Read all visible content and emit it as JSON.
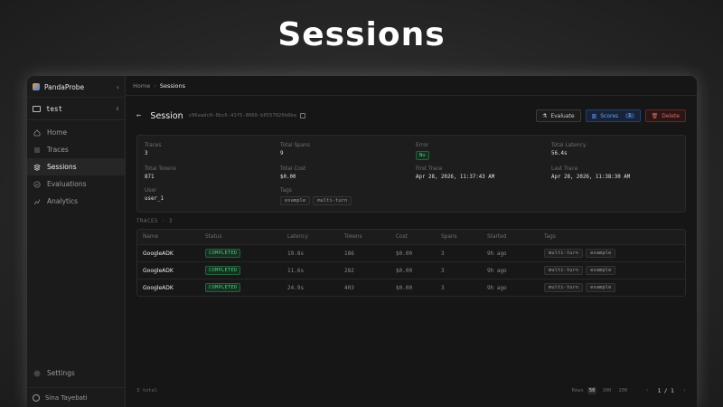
{
  "headline": "Sessions",
  "sidebar": {
    "brand": "PandaProbe",
    "project": "test",
    "items": [
      {
        "label": "Home",
        "icon": "home-icon"
      },
      {
        "label": "Traces",
        "icon": "list-icon"
      },
      {
        "label": "Sessions",
        "icon": "layers-icon",
        "active": true
      },
      {
        "label": "Evaluations",
        "icon": "check-circle-icon"
      },
      {
        "label": "Analytics",
        "icon": "chart-icon"
      }
    ],
    "settings": "Settings",
    "user": "Sina Tayebati"
  },
  "breadcrumb": {
    "home": "Home",
    "current": "Sessions"
  },
  "session": {
    "title": "Session",
    "id": "c06eadc0-0bc6-41f5-8060-b6557826b6ba",
    "actions": {
      "evaluate": "Evaluate",
      "scores": "Scores",
      "scores_count": "1",
      "delete": "Delete"
    }
  },
  "summary": {
    "traces": {
      "label": "Traces",
      "value": "3"
    },
    "total_spans": {
      "label": "Total Spans",
      "value": "9"
    },
    "error": {
      "label": "Error",
      "value": "No"
    },
    "total_latency": {
      "label": "Total Latency",
      "value": "56.4s"
    },
    "total_tokens": {
      "label": "Total Tokens",
      "value": "871"
    },
    "total_cost": {
      "label": "Total Cost",
      "value": "$0.00"
    },
    "first_trace": {
      "label": "First Trace",
      "value": "Apr 28, 2026, 11:37:43 AM"
    },
    "last_trace": {
      "label": "Last Trace",
      "value": "Apr 28, 2026, 11:38:30 AM"
    },
    "user": {
      "label": "User",
      "value": "user_1"
    },
    "tags": {
      "label": "Tags",
      "values": [
        "example",
        "multi-turn"
      ]
    }
  },
  "traces_label": "TRACES · 3",
  "table": {
    "columns": [
      "Name",
      "Status",
      "Latency",
      "Tokens",
      "Cost",
      "Spans",
      "Started",
      "Tags"
    ],
    "rows": [
      {
        "name": "GoogleADK",
        "status": "COMPLETED",
        "latency": "19.8s",
        "tokens": "186",
        "cost": "$0.00",
        "spans": "3",
        "started": "9h ago",
        "tags": [
          "multi-turn",
          "example"
        ]
      },
      {
        "name": "GoogleADK",
        "status": "COMPLETED",
        "latency": "11.6s",
        "tokens": "282",
        "cost": "$0.00",
        "spans": "3",
        "started": "9h ago",
        "tags": [
          "multi-turn",
          "example"
        ]
      },
      {
        "name": "GoogleADK",
        "status": "COMPLETED",
        "latency": "24.9s",
        "tokens": "403",
        "cost": "$0.00",
        "spans": "3",
        "started": "9h ago",
        "tags": [
          "multi-turn",
          "example"
        ]
      }
    ]
  },
  "footer": {
    "total": "3 total",
    "rows_label": "Rows",
    "page_sizes": [
      "50",
      "100",
      "200"
    ],
    "active_size": "50",
    "page": "1 / 1"
  },
  "colors": {
    "accent_blue": "#6ea1e8",
    "success": "#4ad07a",
    "danger": "#e06a6a",
    "background": "#161616"
  }
}
